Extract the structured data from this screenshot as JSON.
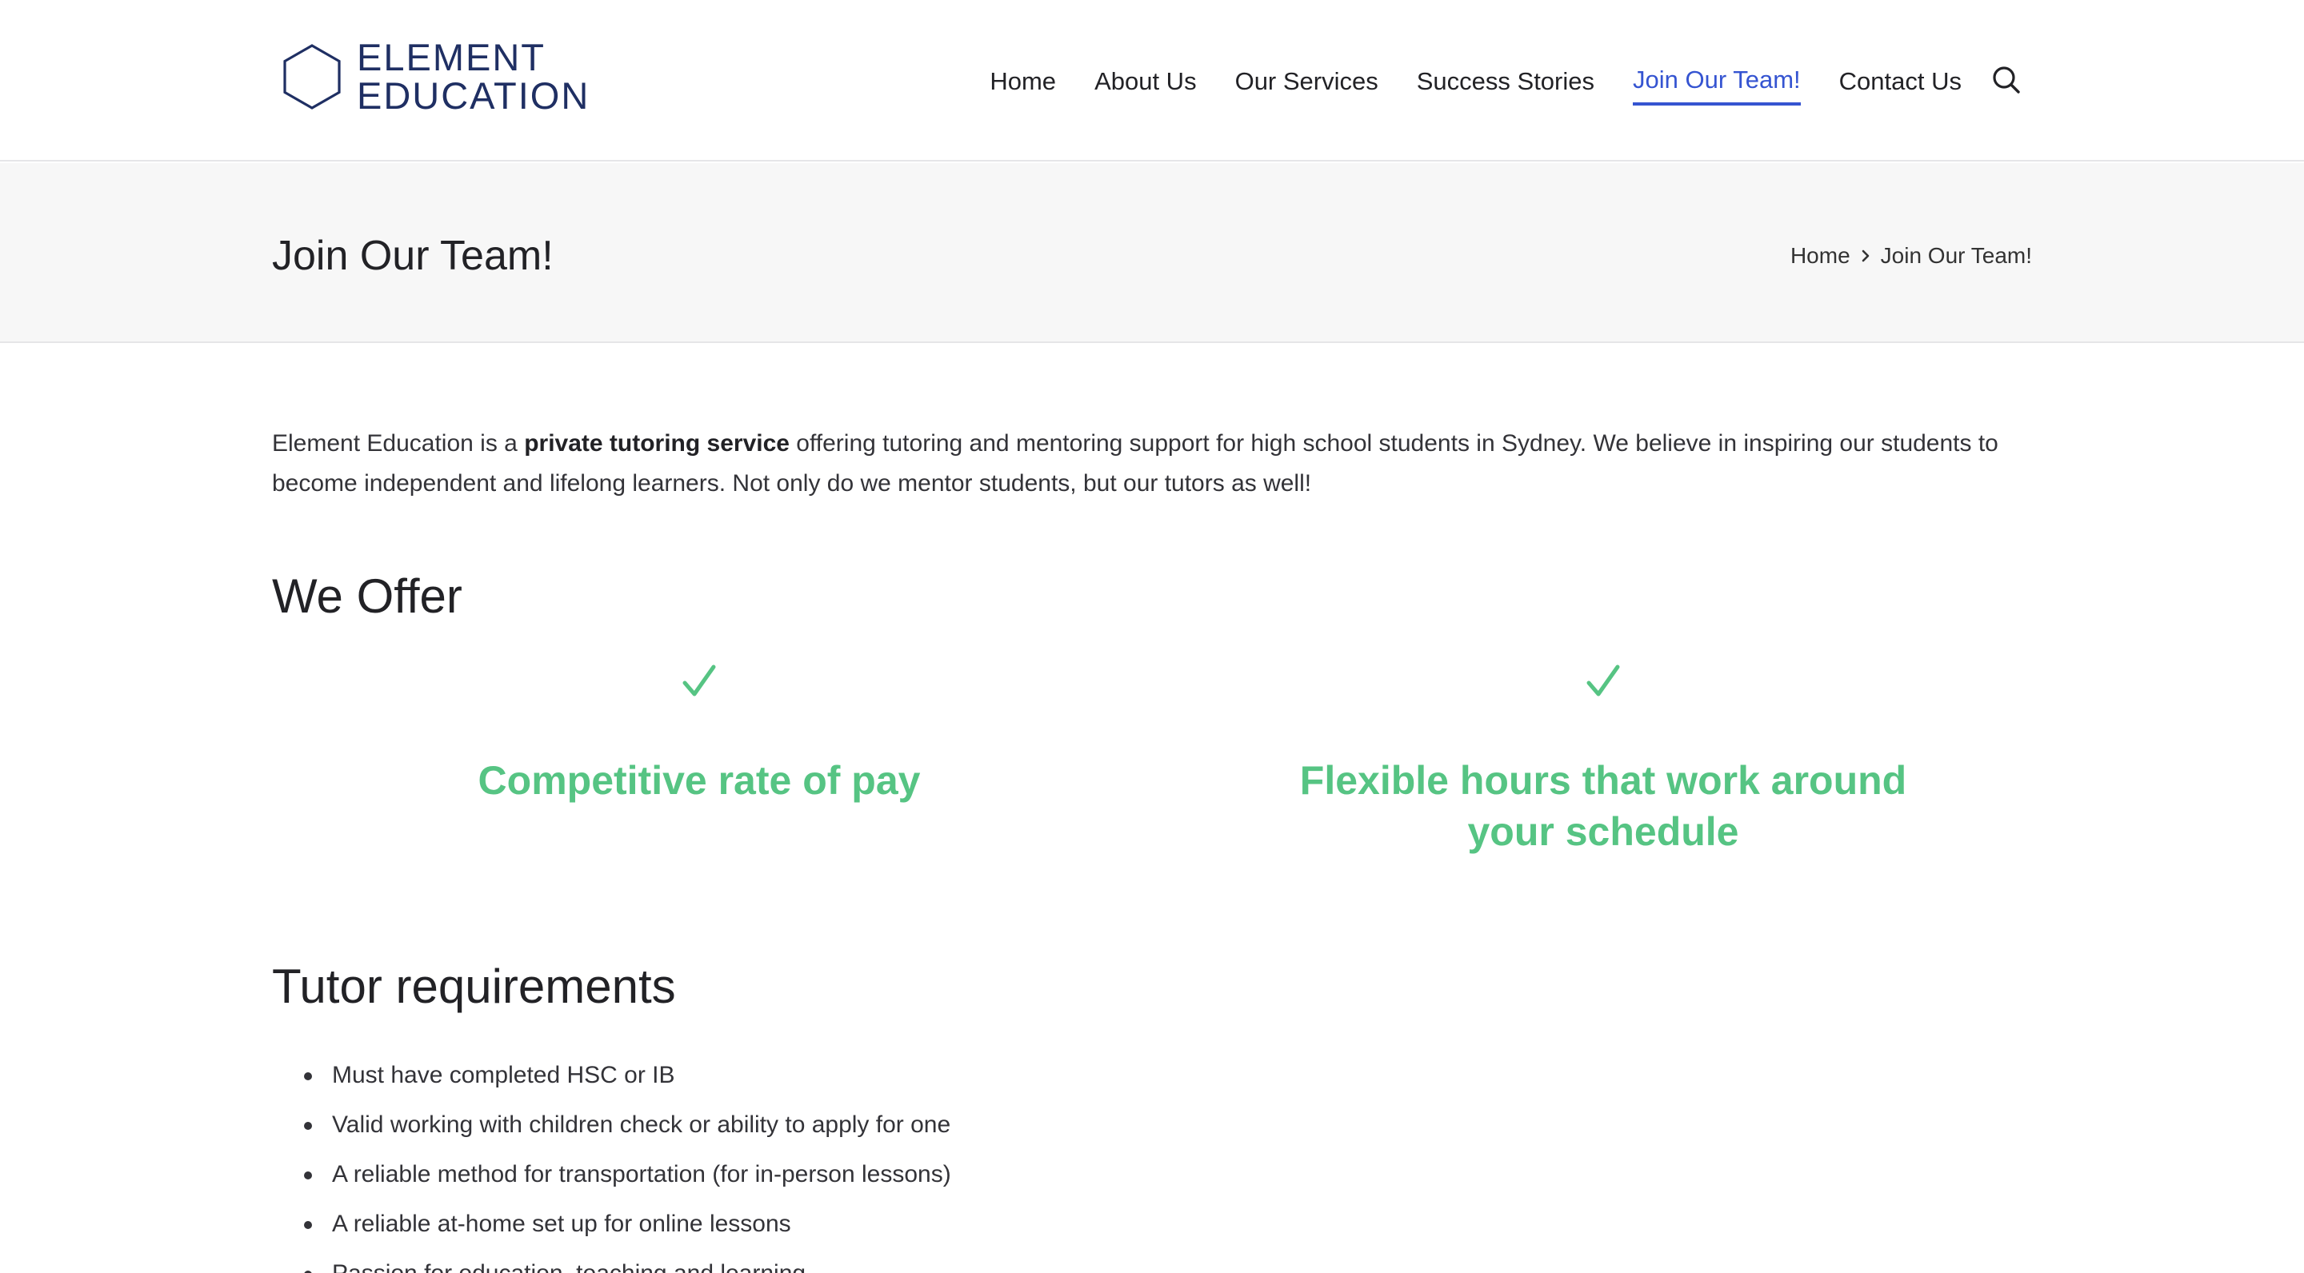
{
  "brand": {
    "line1": "ELEMENT",
    "line2": "EDUCATION",
    "color": "#1f2f63"
  },
  "nav": {
    "items": [
      {
        "label": "Home"
      },
      {
        "label": "About Us"
      },
      {
        "label": "Our Services"
      },
      {
        "label": "Success Stories"
      },
      {
        "label": "Join Our Team!",
        "active": true
      },
      {
        "label": "Contact Us"
      }
    ],
    "search_icon": "search-icon",
    "active_color": "#3554d1"
  },
  "page": {
    "title": "Join Our Team!",
    "breadcrumb": {
      "home": "Home",
      "separator_icon": "chevron-right-icon",
      "current": "Join Our Team!"
    }
  },
  "intro": {
    "part1": "Element Education is a ",
    "bold": "private tutoring service",
    "part2": " offering tutoring and mentoring support for high school students in Sydney. We believe in inspiring our students to become independent and lifelong learners. Not only do we mentor students, but our tutors as well!"
  },
  "offer": {
    "heading": "We Offer",
    "accent_color": "#56c483",
    "items": [
      {
        "icon": "checkmark-icon",
        "title": "Competitive rate of pay"
      },
      {
        "icon": "checkmark-icon",
        "title": "Flexible hours that work around your schedule"
      }
    ]
  },
  "requirements": {
    "heading": "Tutor requirements",
    "items": [
      "Must have completed HSC or IB",
      "Valid working with children check or ability to apply for one",
      "A reliable method for transportation (for in-person lessons)",
      "A reliable at-home set up for online lessons",
      "Passion for education, teaching and learning"
    ]
  }
}
